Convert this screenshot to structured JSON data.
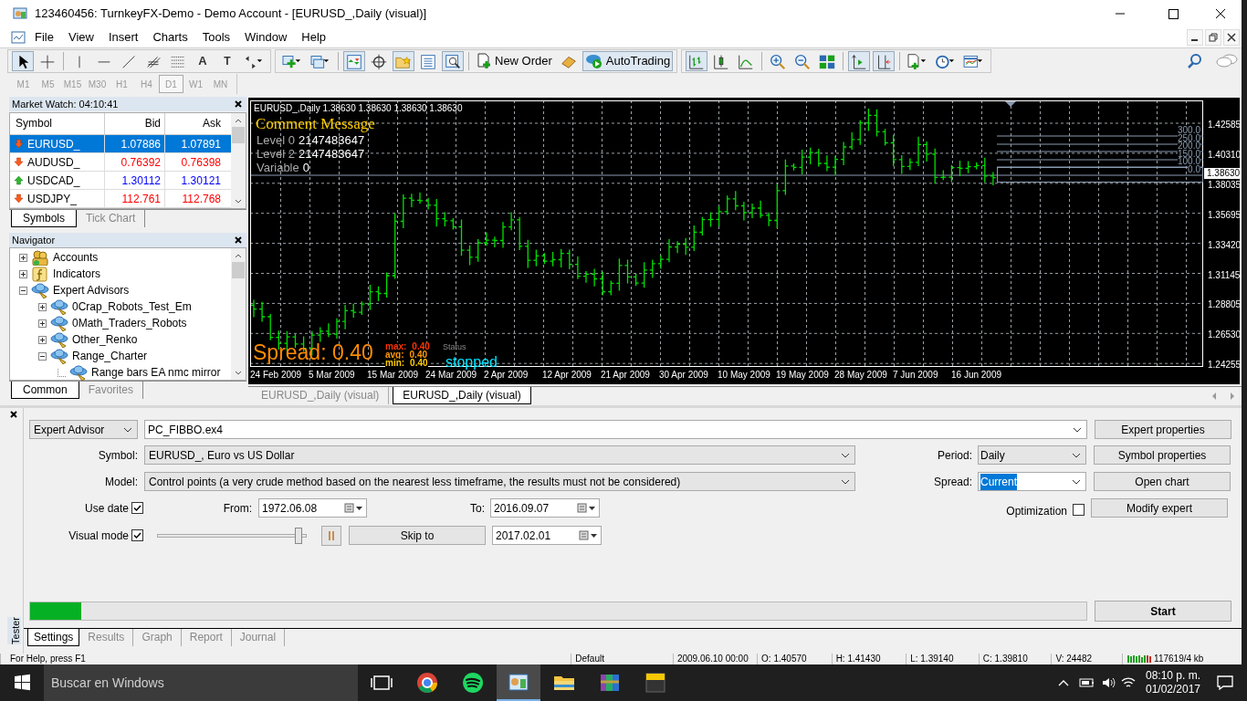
{
  "window": {
    "title": "123460456: TurnkeyFX-Demo - Demo Account - [EURUSD_,Daily (visual)]"
  },
  "menu": [
    "File",
    "View",
    "Insert",
    "Charts",
    "Tools",
    "Window",
    "Help"
  ],
  "toolbar": [
    {
      "kind": "cursor",
      "pressed": true
    },
    {
      "kind": "crosshair",
      "pressed": false
    },
    {
      "kind": "sep"
    },
    {
      "kind": "vline",
      "pressed": false
    },
    {
      "kind": "hline",
      "pressed": false
    },
    {
      "kind": "trendline",
      "pressed": false
    },
    {
      "kind": "channel",
      "pressed": false
    },
    {
      "kind": "fibo",
      "pressed": false
    },
    {
      "kind": "text",
      "glyph": "A",
      "pressed": false
    },
    {
      "kind": "label",
      "glyph": "T",
      "pressed": false
    },
    {
      "kind": "arrows",
      "pressed": false
    },
    {
      "kind": "group"
    },
    {
      "kind": "new-chart",
      "pressed": false
    },
    {
      "kind": "profiles",
      "pressed": false
    },
    {
      "kind": "sep"
    },
    {
      "kind": "market-watch",
      "pressed": true
    },
    {
      "kind": "data-window",
      "pressed": false
    },
    {
      "kind": "navigator",
      "pressed": true
    },
    {
      "kind": "terminal",
      "pressed": false
    },
    {
      "kind": "tester",
      "pressed": true
    },
    {
      "kind": "sep"
    },
    {
      "kind": "new-order",
      "label": "New Order",
      "pressed": false
    },
    {
      "kind": "metaeditor",
      "pressed": false
    },
    {
      "kind": "autotrading",
      "label": "AutoTrading",
      "pressed": true
    },
    {
      "kind": "group"
    },
    {
      "kind": "bar-chart",
      "pressed": true
    },
    {
      "kind": "candles",
      "pressed": false
    },
    {
      "kind": "line-chart",
      "pressed": false
    },
    {
      "kind": "sep"
    },
    {
      "kind": "zoom-in",
      "pressed": false
    },
    {
      "kind": "zoom-out",
      "pressed": false
    },
    {
      "kind": "tile",
      "pressed": false
    },
    {
      "kind": "sep"
    },
    {
      "kind": "autoscroll",
      "pressed": true
    },
    {
      "kind": "shift",
      "pressed": true
    },
    {
      "kind": "sep"
    },
    {
      "kind": "indicators",
      "pressed": false
    },
    {
      "kind": "periods",
      "pressed": false
    },
    {
      "kind": "templates",
      "pressed": false
    }
  ],
  "timeframes": [
    {
      "label": "M1",
      "selected": false
    },
    {
      "label": "M5",
      "selected": false
    },
    {
      "label": "M15",
      "selected": false
    },
    {
      "label": "M30",
      "selected": false
    },
    {
      "label": "H1",
      "selected": false
    },
    {
      "label": "H4",
      "selected": false
    },
    {
      "label": "D1",
      "selected": true
    },
    {
      "label": "W1",
      "selected": false
    },
    {
      "label": "MN",
      "selected": false
    }
  ],
  "market_watch": {
    "title": "Market Watch: 04:10:41",
    "columns": [
      "Symbol",
      "Bid",
      "Ask"
    ],
    "rows": [
      {
        "symbol": "EURUSD_",
        "bid": "1.07886",
        "ask": "1.07891",
        "rising": false,
        "selected": true
      },
      {
        "symbol": "AUDUSD_",
        "bid": "0.76392",
        "ask": "0.76398",
        "rising": false,
        "selected": false
      },
      {
        "symbol": "USDCAD_",
        "bid": "1.30112",
        "ask": "1.30121",
        "rising": true,
        "selected": false
      },
      {
        "symbol": "USDJPY_",
        "bid": "112.761",
        "ask": "112.768",
        "rising": false,
        "selected": false
      }
    ],
    "tabs": [
      {
        "label": "Symbols",
        "selected": true
      },
      {
        "label": "Tick Chart",
        "selected": false
      }
    ]
  },
  "navigator": {
    "title": "Navigator",
    "tree": [
      {
        "label": "Accounts",
        "kind": "accounts",
        "expanded": false
      },
      {
        "label": "Indicators",
        "kind": "indicators",
        "expanded": false
      },
      {
        "label": "Expert Advisors",
        "kind": "experts",
        "expanded": true,
        "children": [
          {
            "label": "0Crap_Robots_Test_Em",
            "kind": "experts",
            "expanded": false
          },
          {
            "label": "0Math_Traders_Robots",
            "kind": "experts",
            "expanded": false
          },
          {
            "label": "Other_Renko",
            "kind": "experts",
            "expanded": false
          },
          {
            "label": "Range_Charter",
            "kind": "experts",
            "expanded": true,
            "children": [
              {
                "label": "Range bars EA nmc mirror",
                "kind": "experts"
              }
            ]
          }
        ]
      }
    ],
    "tabs": [
      {
        "label": "Common",
        "selected": true
      },
      {
        "label": "Favorites",
        "selected": false
      }
    ]
  },
  "chart": {
    "header": "EURUSD_,Daily  1.38630 1.38630 1.38630 1.38630",
    "comment_title": "Comment Message",
    "comment_lines": [
      {
        "label": "Level 0",
        "value": "2147483647"
      },
      {
        "label": "Level 2",
        "value": "2147483647"
      },
      {
        "label": "Variable",
        "value": "0"
      }
    ],
    "spread": "Spread: 0.40",
    "spread_stats": [
      {
        "label": "max:",
        "value": "0.40",
        "color": "#ff3300"
      },
      {
        "label": "avg:",
        "value": "0.40",
        "color": "#ff9900"
      },
      {
        "label": "min:",
        "value": "0.40",
        "color": "#ffcc00"
      }
    ],
    "status_label": "Status",
    "status": "stopped",
    "price_labels": [
      "1.42585",
      "1.40310",
      "1.38035",
      "1.35695",
      "1.33420",
      "1.31145",
      "1.28805",
      "1.26530",
      "1.24255"
    ],
    "current_price": "1.38630",
    "fibo_levels": [
      "300.0",
      "250.0",
      "200.0",
      "150.0",
      "100.0",
      "0.0"
    ],
    "date_labels": [
      "24 Feb 2009",
      "5 Mar 2009",
      "15 Mar 2009",
      "24 Mar 2009",
      "2 Apr 2009",
      "12 Apr 2009",
      "21 Apr 2009",
      "30 Apr 2009",
      "10 May 2009",
      "19 May 2009",
      "28 May 2009",
      "7 Jun 2009",
      "16 Jun 2009"
    ]
  },
  "chart_tabs": [
    {
      "label": "EURUSD_,Daily (visual)",
      "selected": false
    },
    {
      "label": "EURUSD_,Daily (visual)",
      "selected": true
    }
  ],
  "tester": {
    "title": "Tester",
    "mode": "Expert Advisor",
    "expert": "PC_FIBBO.ex4",
    "symbol_label": "Symbol:",
    "symbol": "EURUSD_, Euro vs US Dollar",
    "model_label": "Model:",
    "model": "Control points (a very crude method based on the nearest less timeframe, the results must not be considered)",
    "period_label": "Period:",
    "period": "Daily",
    "spread_label": "Spread:",
    "spread": "Current",
    "use_date": {
      "label": "Use date",
      "checked": true
    },
    "from_label": "From:",
    "from": "1972.06.08",
    "to_label": "To:",
    "to": "2016.09.07",
    "optimization": {
      "label": "Optimization",
      "checked": false
    },
    "visual_mode": {
      "label": "Visual mode",
      "checked": true
    },
    "speed": {
      "level": 0.96
    },
    "skip_button": "Skip to",
    "skip_date": "2017.02.01",
    "buttons": [
      "Expert properties",
      "Symbol properties",
      "Open chart",
      "Modify expert"
    ],
    "progress": {
      "level": 0.048
    },
    "start": "Start",
    "tabs": [
      {
        "label": "Settings",
        "selected": true
      },
      {
        "label": "Results",
        "selected": false
      },
      {
        "label": "Graph",
        "selected": false
      },
      {
        "label": "Report",
        "selected": false
      },
      {
        "label": "Journal",
        "selected": false
      }
    ]
  },
  "status_bar": [
    "For Help, press F1",
    "Default",
    "2009.06.10 00:00",
    "O: 1.40570",
    "H: 1.41430",
    "L: 1.39140",
    "C: 1.39810",
    "V: 24482",
    "117619/4 kb"
  ],
  "taskbar": {
    "placeholder": "Buscar en Windows",
    "apps": [
      {
        "kind": "taskview",
        "selected": false
      },
      {
        "kind": "ring",
        "selected": false
      },
      {
        "kind": "waves",
        "selected": false
      },
      {
        "kind": "terminal",
        "selected": true
      },
      {
        "kind": "folder",
        "selected": false
      },
      {
        "kind": "books",
        "selected": false
      },
      {
        "kind": "tile",
        "selected": false
      }
    ],
    "time": "08:10 p. m.",
    "date": "01/02/2017"
  }
}
